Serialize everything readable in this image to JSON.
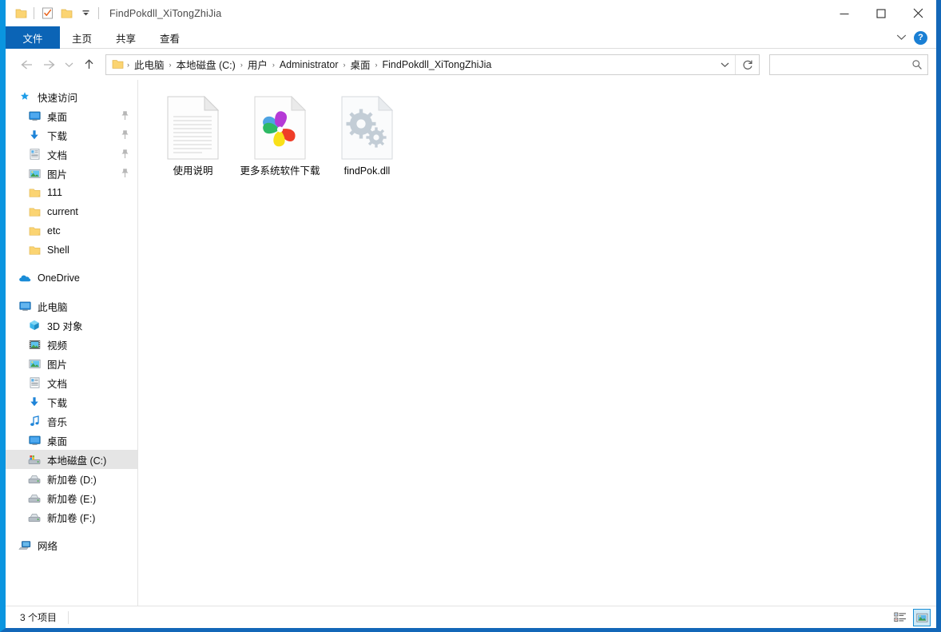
{
  "window": {
    "title": "FindPokdll_XiTongZhiJia",
    "quick_access_toolbar": [
      {
        "name": "folder-icon",
        "label": "属性"
      },
      {
        "name": "properties-icon",
        "label": "属性"
      },
      {
        "name": "new-folder-icon",
        "label": "新建文件夹"
      },
      {
        "name": "chevron-down-icon",
        "label": "自定义快速访问工具栏"
      }
    ],
    "caption": {
      "minimize": "—",
      "maximize": "□",
      "close": "✕"
    }
  },
  "ribbon": {
    "tabs": [
      {
        "label": "文件",
        "active": true
      },
      {
        "label": "主页",
        "active": false
      },
      {
        "label": "共享",
        "active": false
      },
      {
        "label": "查看",
        "active": false
      }
    ],
    "collapse_label": "⌄",
    "help_label": "?"
  },
  "navbar": {
    "back_label": "←",
    "forward_label": "→",
    "recent_label": "⌄",
    "up_label": "↑",
    "breadcrumbs": [
      "此电脑",
      "本地磁盘 (C:)",
      "用户",
      "Administrator",
      "桌面",
      "FindPokdll_XiTongZhiJia"
    ],
    "separator": "›",
    "dropdown_label": "⌄",
    "refresh_label": "↻"
  },
  "search": {
    "value": "",
    "placeholder": "",
    "icon": "search-icon"
  },
  "sidebar": {
    "sections": [
      {
        "header": {
          "label": "快速访问",
          "icon": "star-pin-icon"
        },
        "items": [
          {
            "label": "桌面",
            "icon": "desktop-icon",
            "pinned": true
          },
          {
            "label": "下载",
            "icon": "download-icon",
            "pinned": true
          },
          {
            "label": "文档",
            "icon": "documents-icon",
            "pinned": true
          },
          {
            "label": "图片",
            "icon": "pictures-icon",
            "pinned": true
          },
          {
            "label": "111",
            "icon": "folder-icon",
            "pinned": false
          },
          {
            "label": "current",
            "icon": "folder-icon",
            "pinned": false
          },
          {
            "label": "etc",
            "icon": "folder-icon",
            "pinned": false
          },
          {
            "label": "Shell",
            "icon": "folder-icon",
            "pinned": false
          }
        ]
      },
      {
        "header": {
          "label": "OneDrive",
          "icon": "onedrive-cloud-icon"
        },
        "items": []
      },
      {
        "header": {
          "label": "此电脑",
          "icon": "this-pc-icon"
        },
        "items": [
          {
            "label": "3D 对象",
            "icon": "3d-objects-icon",
            "pinned": false
          },
          {
            "label": "视频",
            "icon": "videos-icon",
            "pinned": false
          },
          {
            "label": "图片",
            "icon": "pictures-icon",
            "pinned": false
          },
          {
            "label": "文档",
            "icon": "documents-icon",
            "pinned": false
          },
          {
            "label": "下载",
            "icon": "download-icon",
            "pinned": false
          },
          {
            "label": "音乐",
            "icon": "music-icon",
            "pinned": false
          },
          {
            "label": "桌面",
            "icon": "desktop-icon",
            "pinned": false
          },
          {
            "label": "本地磁盘 (C:)",
            "icon": "system-drive-icon",
            "pinned": false,
            "selected": true
          },
          {
            "label": "新加卷 (D:)",
            "icon": "drive-icon",
            "pinned": false
          },
          {
            "label": "新加卷 (E:)",
            "icon": "drive-icon",
            "pinned": false
          },
          {
            "label": "新加卷 (F:)",
            "icon": "drive-icon",
            "pinned": false
          }
        ]
      },
      {
        "header": {
          "label": "网络",
          "icon": "network-icon"
        },
        "items": []
      }
    ]
  },
  "files": [
    {
      "name": "使用说明",
      "icon": "text-document-icon"
    },
    {
      "name": "更多系统软件下载",
      "icon": "pinwheel-browser-icon"
    },
    {
      "name": "findPok.dll",
      "icon": "dll-gears-icon"
    }
  ],
  "statusbar": {
    "item_count": "3 个项目",
    "views": [
      {
        "name": "details-view-button",
        "selected": false
      },
      {
        "name": "large-icons-view-button",
        "selected": true
      }
    ]
  },
  "colors": {
    "accent_blue": "#0a95e0",
    "tab_blue": "#0b64b6",
    "window_border": "#1367b8",
    "selection_gray": "#e5e5e5",
    "view_selected": "#cce8f6"
  }
}
